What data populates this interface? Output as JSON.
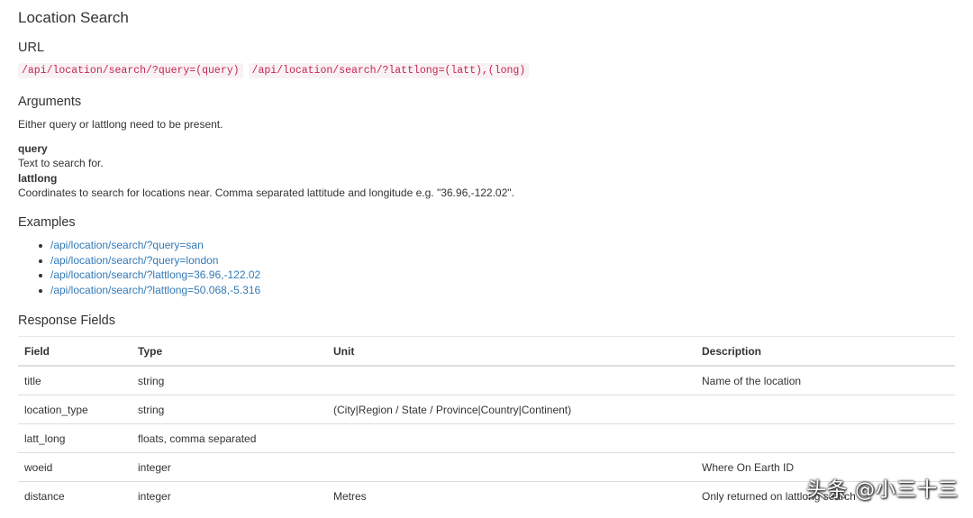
{
  "page_title": "Location Search",
  "url_section": {
    "heading": "URL",
    "codes": [
      "/api/location/search/?query=(query)",
      "/api/location/search/?lattlong=(latt),(long)"
    ]
  },
  "arguments": {
    "heading": "Arguments",
    "intro": "Either query or lattlong need to be present.",
    "items": [
      {
        "name": "query",
        "desc": "Text to search for."
      },
      {
        "name": "lattlong",
        "desc": "Coordinates to search for locations near. Comma separated lattitude and longitude e.g. \"36.96,-122.02\"."
      }
    ]
  },
  "examples": {
    "heading": "Examples",
    "links": [
      "/api/location/search/?query=san",
      "/api/location/search/?query=london",
      "/api/location/search/?lattlong=36.96,-122.02",
      "/api/location/search/?lattlong=50.068,-5.316"
    ]
  },
  "response_fields": {
    "heading": "Response Fields",
    "columns": [
      "Field",
      "Type",
      "Unit",
      "Description"
    ],
    "rows": [
      [
        "title",
        "string",
        "",
        "Name of the location"
      ],
      [
        "location_type",
        "string",
        "(City|Region / State / Province|Country|Continent)",
        ""
      ],
      [
        "latt_long",
        "floats, comma separated",
        "",
        ""
      ],
      [
        "woeid",
        "integer",
        "",
        "Where On Earth ID"
      ],
      [
        "distance",
        "integer",
        "Metres",
        "Only returned on lattlong search"
      ]
    ]
  },
  "watermark": "头条 @小三十三",
  "colors": {
    "code_text": "#c7254e",
    "code_bg": "#f9f2f4",
    "link": "#337ab7",
    "border": "#dddddd"
  }
}
